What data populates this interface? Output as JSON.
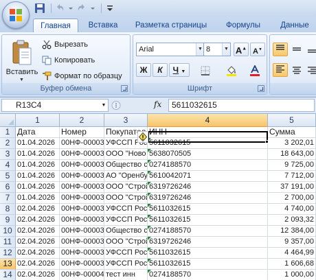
{
  "ribbon": {
    "tabs": [
      "Главная",
      "Вставка",
      "Разметка страницы",
      "Формулы",
      "Данные"
    ],
    "clipboard": {
      "paste": "Вставить",
      "cut": "Вырезать",
      "copy": "Копировать",
      "format_painter": "Формат по образцу",
      "group_label": "Буфер обмена"
    },
    "font": {
      "name": "Arial",
      "size": "8",
      "bold": "Ж",
      "italic": "К",
      "underline": "Ч",
      "group_label": "Шрифт"
    }
  },
  "formula_bar": {
    "name_box": "R13C4",
    "fx": "fx",
    "value": "5611032615"
  },
  "grid": {
    "columns": [
      "1",
      "2",
      "3",
      "4",
      "5"
    ],
    "rows": [
      {
        "n": "1",
        "cells": [
          "Дата",
          "Номер",
          "Покупател",
          "ИНН",
          "Сумма"
        ]
      },
      {
        "n": "2",
        "cells": [
          "01.04.2026",
          "00НФ-00003",
          "УФССП Рос",
          "5611032615",
          "3 202,01"
        ]
      },
      {
        "n": "3",
        "cells": [
          "01.04.2026",
          "00НФ-00003",
          "ООО \"Ново",
          "5638070505",
          "18 643,00"
        ]
      },
      {
        "n": "4",
        "cells": [
          "01.04.2026",
          "00НФ-00003",
          "Общество с",
          "0274188570",
          "9 725,00"
        ]
      },
      {
        "n": "5",
        "cells": [
          "01.04.2026",
          "00НФ-00003",
          "АО \"Оренбу",
          "5610042071",
          "7 712,00"
        ]
      },
      {
        "n": "6",
        "cells": [
          "01.04.2026",
          "00НФ-00003",
          "ООО \"Строй",
          "6319726246",
          "37 191,00"
        ]
      },
      {
        "n": "7",
        "cells": [
          "01.04.2026",
          "00НФ-00003",
          "ООО \"Строй",
          "6319726246",
          "2 700,00"
        ]
      },
      {
        "n": "8",
        "cells": [
          "02.04.2026",
          "00НФ-00003",
          "УФССП Рос",
          "5611032615",
          "4 740,00"
        ]
      },
      {
        "n": "9",
        "cells": [
          "02.04.2026",
          "00НФ-00003",
          "УФССП Рос",
          "5611032615",
          "2 093,32"
        ]
      },
      {
        "n": "10",
        "cells": [
          "02.04.2026",
          "00НФ-00003",
          "Общество с",
          "0274188570",
          "12 384,00"
        ]
      },
      {
        "n": "11",
        "cells": [
          "02.04.2026",
          "00НФ-00003",
          "ООО \"Строй",
          "6319726246",
          "9 357,00"
        ]
      },
      {
        "n": "12",
        "cells": [
          "02.04.2026",
          "00НФ-00003",
          "УФССП Рос",
          "5611032615",
          "4 464,99"
        ]
      },
      {
        "n": "13",
        "cells": [
          "02.04.2026",
          "00НФ-00003",
          "УФССП Рос",
          "5611032615",
          "1 606,68"
        ]
      },
      {
        "n": "14",
        "cells": [
          "02.04.2026",
          "00НФ-00004",
          "тест инн",
          "0274188570",
          "1 000,00"
        ]
      },
      {
        "n": "15",
        "cells": [
          "",
          "",
          "",
          "",
          ""
        ]
      }
    ],
    "selected_cell": "R13C4"
  },
  "colors": {
    "ribbon_blue": "#dbe7f6",
    "selected_header": "#f7c56a",
    "error_marker": "#1e8a2c"
  }
}
